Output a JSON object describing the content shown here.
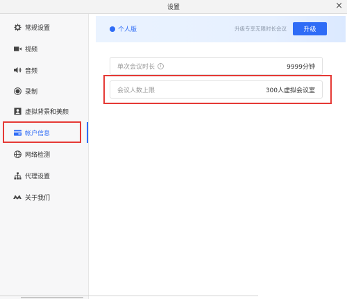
{
  "window": {
    "title": "设置",
    "close": "×"
  },
  "sidebar": {
    "items": [
      {
        "label": "常规设置",
        "icon": "gear-icon"
      },
      {
        "label": "视频",
        "icon": "video-camera-icon"
      },
      {
        "label": "音频",
        "icon": "speaker-icon"
      },
      {
        "label": "录制",
        "icon": "record-icon"
      },
      {
        "label": "虚拟背景和美颜",
        "icon": "portrait-icon"
      },
      {
        "label": "帐户信息",
        "icon": "card-icon",
        "active": true
      },
      {
        "label": "网络检测",
        "icon": "globe-icon"
      },
      {
        "label": "代理设置",
        "icon": "network-tree-icon"
      },
      {
        "label": "关于我们",
        "icon": "logo-icon"
      }
    ]
  },
  "banner": {
    "plan": "个人版",
    "promo": "升级专享无限时长会议",
    "upgrade_label": "升级"
  },
  "account": {
    "duration_label": "单次会议时长",
    "duration_value": "9999分钟",
    "attendees_label": "会议人数上限",
    "attendees_value": "300人虚拟会议室"
  },
  "colors": {
    "accent": "#2f6cf6",
    "highlight": "#e53935"
  }
}
